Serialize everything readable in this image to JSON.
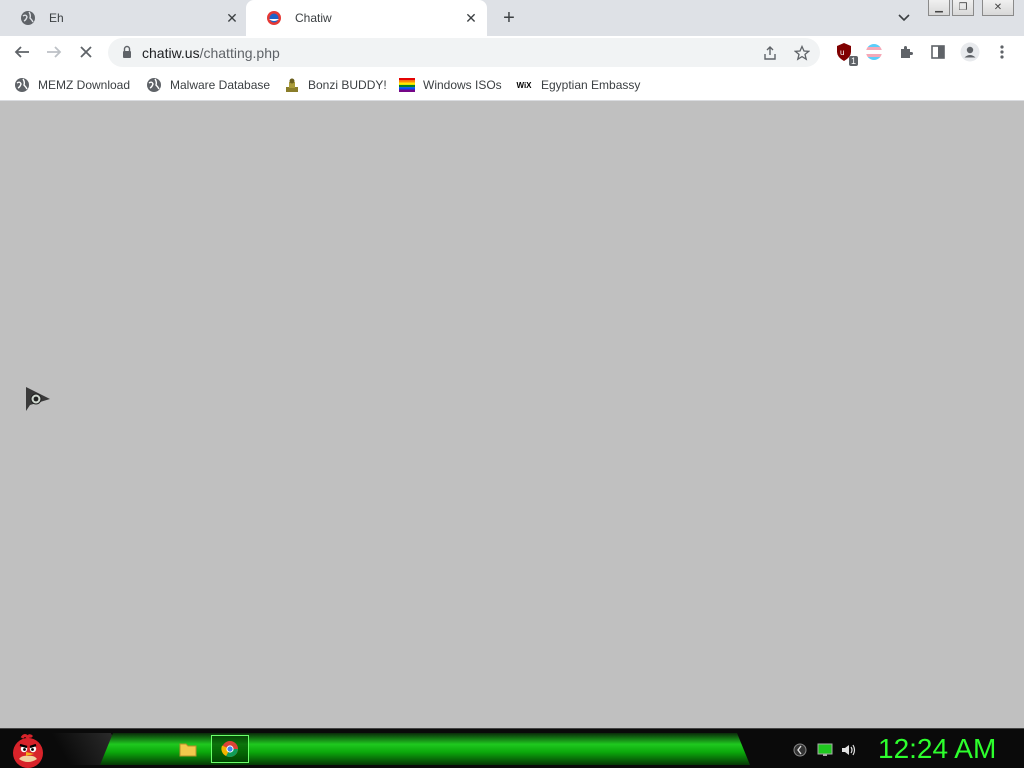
{
  "browser": {
    "tabs": [
      {
        "title": "Eh",
        "favicon": "globe-icon",
        "active": false
      },
      {
        "title": "Chatiw",
        "favicon": "chatiw-icon",
        "active": true
      }
    ],
    "window_controls": [
      "minimize-icon",
      "restore-icon",
      "close-icon"
    ]
  },
  "toolbar": {
    "url_host": "chatiw.us",
    "url_path": "/chatting.php",
    "extension_badge": "1"
  },
  "bookmarks": [
    {
      "label": "MEMZ Download",
      "icon": "globe-icon"
    },
    {
      "label": "Malware Database",
      "icon": "globe-icon"
    },
    {
      "label": "Bonzi BUDDY!",
      "icon": "bonzi-icon"
    },
    {
      "label": "Windows ISOs",
      "icon": "rainbow-flag-icon"
    },
    {
      "label": "Egyptian Embassy",
      "icon": "wix-icon"
    }
  ],
  "taskbar": {
    "clock": "12:24 AM",
    "apps": [
      "folder-icon",
      "chrome-icon"
    ]
  },
  "colors": {
    "page_background": "#c0c0c0",
    "taskbar_accent": "#1fc81f",
    "clock_color": "#2dff2d"
  }
}
